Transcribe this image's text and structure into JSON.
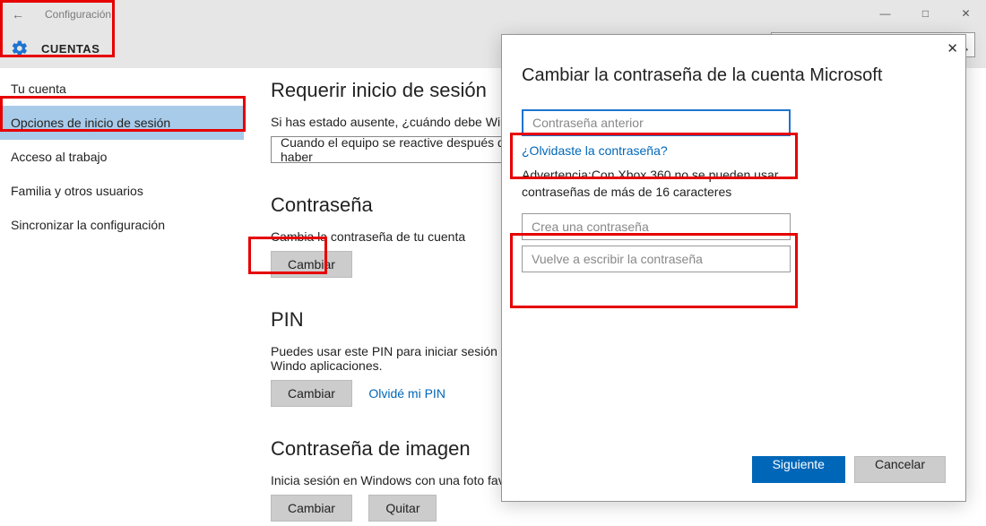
{
  "titlebar": {
    "title": "Configuración"
  },
  "header": {
    "page": "CUENTAS"
  },
  "sidebar": {
    "items": [
      {
        "label": "Tu cuenta",
        "selected": false
      },
      {
        "label": "Opciones de inicio de sesión",
        "selected": true
      },
      {
        "label": "Acceso al trabajo",
        "selected": false
      },
      {
        "label": "Familia y otros usuarios",
        "selected": false
      },
      {
        "label": "Sincronizar la configuración",
        "selected": false
      }
    ]
  },
  "content": {
    "require_signin": {
      "heading": "Requerir inicio de sesión",
      "prompt": "Si has estado ausente, ¿cuándo debe Windows so",
      "select_value": "Cuando el equipo se reactive después de haber"
    },
    "password": {
      "heading": "Contraseña",
      "prompt": "Cambia la contraseña de tu cuenta",
      "change_label": "Cambiar"
    },
    "pin": {
      "heading": "PIN",
      "prompt": "Puedes usar este PIN para iniciar sesión en Windo aplicaciones.",
      "change_label": "Cambiar",
      "forgot_label": "Olvidé mi PIN"
    },
    "picture_password": {
      "heading": "Contraseña de imagen",
      "prompt": "Inicia sesión en Windows con una foto favorita",
      "change_label": "Cambiar",
      "remove_label": "Quitar"
    }
  },
  "dialog": {
    "title": "Cambiar la contraseña de la cuenta Microsoft",
    "old_password_placeholder": "Contraseña anterior",
    "forgot_link": "¿Olvidaste la contraseña?",
    "warning_text": "Advertencia:Con Xbox 360 no se pueden usar contraseñas de más de 16 caracteres",
    "new_password_placeholder": "Crea una contraseña",
    "repeat_password_placeholder": "Vuelve a escribir la contraseña",
    "next_label": "Siguiente",
    "cancel_label": "Cancelar"
  }
}
